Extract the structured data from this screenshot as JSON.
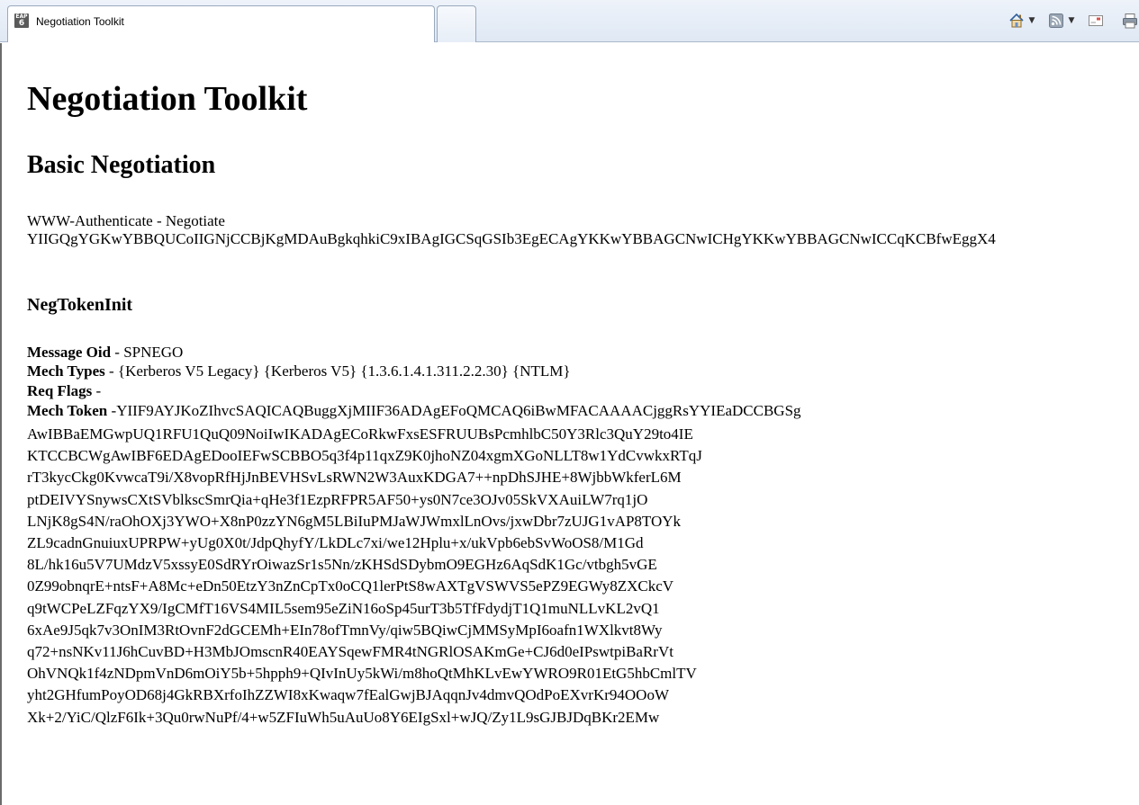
{
  "browser": {
    "tabs": [
      {
        "title": "Negotiation Toolkit",
        "favicon": "EAP 6",
        "active": true
      }
    ],
    "icons": {
      "home": "home-icon",
      "feeds": "feeds-icon",
      "mail": "mail-icon",
      "print": "print-icon",
      "dropdown": "▾"
    }
  },
  "page": {
    "title": "Negotiation Toolkit",
    "section_title": "Basic Negotiation",
    "www_authenticate_header": "WWW-Authenticate - Negotiate",
    "www_authenticate_value": "YIIGQgYGKwYBBQUCoIIGNjCCBjKgMDAuBgkqhkiC9xIBAgIGCSqGSIb3EgECAgYKKwYBBAGCNwICHgYKKwYBBAGCNwICCqKCBfwEggX4",
    "negtokeninit_heading": "NegTokenInit",
    "message_oid": {
      "label": "Message Oid",
      "sep": " - ",
      "value": "SPNEGO"
    },
    "mech_types": {
      "label": "Mech Types",
      "sep": " - ",
      "value": "{Kerberos V5 Legacy} {Kerberos V5} {1.3.6.1.4.1.311.2.2.30} {NTLM}"
    },
    "req_flags": {
      "label": "Req Flags",
      "sep": " - ",
      "value": ""
    },
    "mech_token": {
      "label": "Mech Token",
      "sep": " -",
      "value": "YIIF9AYJKoZIhvcSAQICAQBuggXjMIIF36ADAgEFoQMCAQ6iBwMFACAAAACjggRsYYIEaDCCBGSg"
    },
    "mech_token_lines": [
      "AwIBBaEMGwpUQ1RFU1QuQ09NoiIwIKADAgECoRkwFxsESFRUUBsPcmhlbC50Y3Rlc3QuY29to4IE",
      "KTCCBCWgAwIBF6EDAgEDooIEFwSCBBO5q3f4p11qxZ9K0jhoNZ04xgmXGoNLLT8w1YdCvwkxRTqJ",
      "rT3kycCkg0KvwcaT9i/X8vopRfHjJnBEVHSvLsRWN2W3AuxKDGA7++npDhSJHE+8WjbbWkferL6M",
      "ptDEIVYSnywsCXtSVblkscSmrQia+qHe3f1EzpRFPR5AF50+ys0N7ce3OJv05SkVXAuiLW7rq1jO",
      "LNjK8gS4N/raOhOXj3YWO+X8nP0zzYN6gM5LBiIuPMJaWJWmxlLnOvs/jxwDbr7zUJG1vAP8TOYk",
      "ZL9cadnGnuiuxUPRPW+yUg0X0t/JdpQhyfY/LkDLc7xi/we12Hplu+x/ukVpb6ebSvWoOS8/M1Gd",
      "8L/hk16u5V7UMdzV5xssyE0SdRYrOiwazSr1s5Nn/zKHSdSDybmO9EGHz6AqSdK1Gc/vtbgh5vGE",
      "0Z99obnqrE+ntsF+A8Mc+eDn50EtzY3nZnCpTx0oCQ1lerPtS8wAXTgVSWVS5ePZ9EGWy8ZXCkcV",
      "q9tWCPeLZFqzYX9/IgCMfT16VS4MIL5sem95eZiN16oSp45urT3b5TfFdydjT1Q1muNLLvKL2vQ1",
      "6xAe9J5qk7v3OnIM3RtOvnF2dGCEMh+EIn78ofTmnVy/qiw5BQiwCjMMSyMpI6oafn1WXlkvt8Wy",
      "q72+nsNKv11J6hCuvBD+H3MbJOmscnR40EAYSqewFMR4tNGRlOSAKmGe+CJ6d0eIPswtpiBaRrVt",
      "OhVNQk1f4zNDpmVnD6mOiY5b+5hpph9+QIvInUy5kWi/m8hoQtMhKLvEwYWRO9R01EtG5hbCmlTV",
      "yht2GHfumPoyOD68j4GkRBXrfoIhZZWI8xKwaqw7fEalGwjBJAqqnJv4dmvQOdPoEXvrKr94OOoW",
      "Xk+2/YiC/QlzF6Ik+3Qu0rwNuPf/4+w5ZFIuWh5uAuUo8Y6EIgSxl+wJQ/Zy1L9sGJBJDqBKr2EMw"
    ]
  }
}
